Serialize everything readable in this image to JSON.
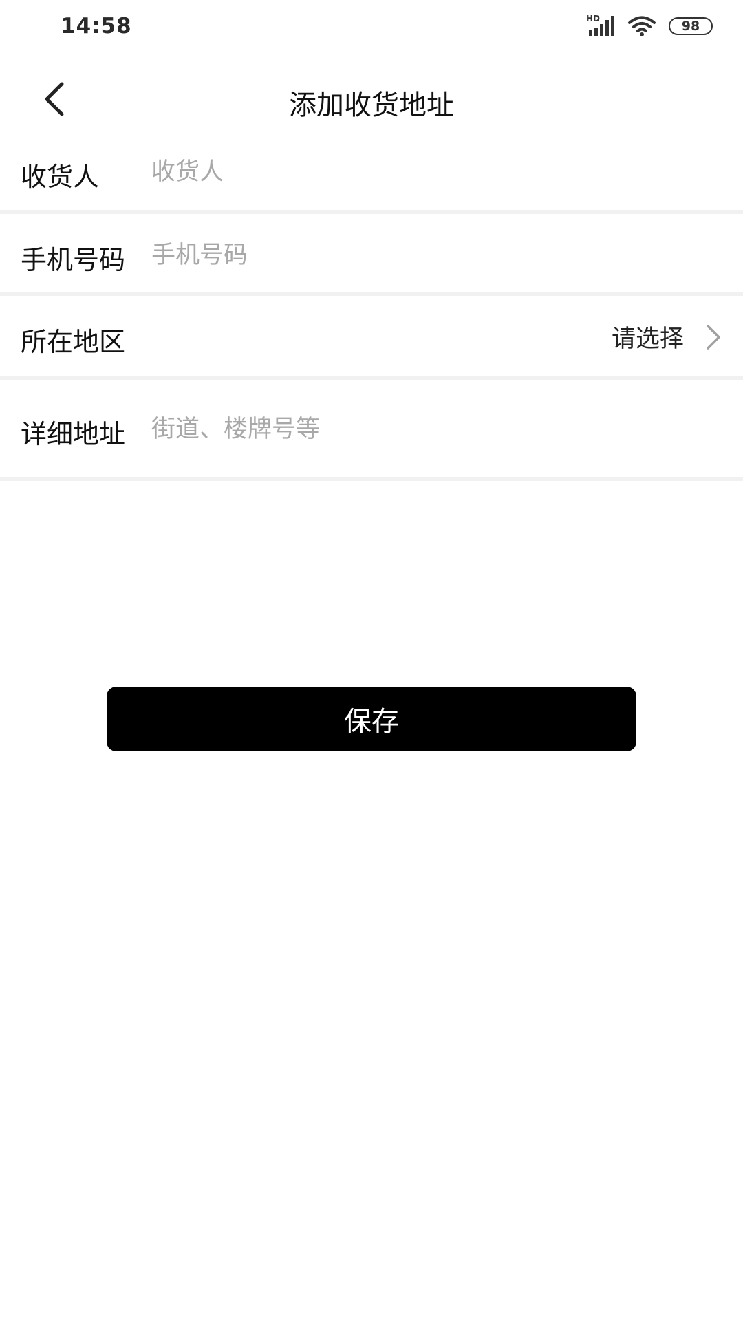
{
  "status_bar": {
    "time": "14:58",
    "network_badge": "HD",
    "battery": "98",
    "icons": [
      "hd-signal-icon",
      "wifi-icon",
      "battery-icon"
    ]
  },
  "header": {
    "title": "添加收货地址",
    "back_icon": "chevron-left-icon"
  },
  "form": {
    "consignee": {
      "label": "收货人",
      "placeholder": "收货人",
      "value": ""
    },
    "phone": {
      "label": "手机号码",
      "placeholder": "手机号码",
      "value": ""
    },
    "region": {
      "label": "所在地区",
      "value": "请选择",
      "icon": "chevron-right-icon"
    },
    "detail": {
      "label": "详细地址",
      "placeholder": "街道、楼牌号等",
      "value": ""
    }
  },
  "actions": {
    "save_label": "保存"
  },
  "colors": {
    "primary_button": "#000000",
    "placeholder": "#a8a8a8",
    "divider": "#f1f1f1",
    "text": "#111111"
  }
}
